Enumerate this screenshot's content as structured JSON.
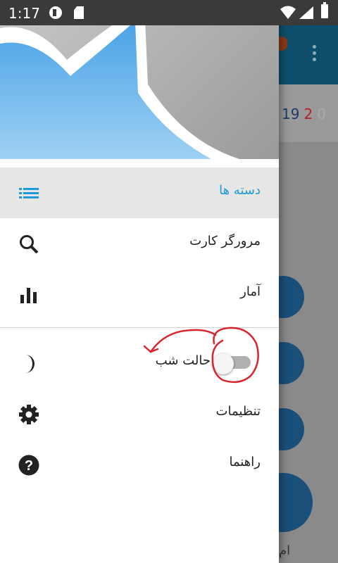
{
  "status_bar": {
    "time": "1:17"
  },
  "background_app": {
    "counts": [
      {
        "value": "19",
        "color": "#1a3a66"
      },
      {
        "value": "2",
        "color": "#b0202a"
      },
      {
        "value": "0",
        "color": "#aaaaaa"
      }
    ],
    "bottom_text": "ام"
  },
  "drawer": {
    "menu": [
      {
        "id": "categories",
        "label": "دسته ها",
        "icon": "list-icon",
        "selected": true
      },
      {
        "id": "card-browser",
        "label": "مرورگر کارت",
        "icon": "search-icon"
      },
      {
        "id": "statistics",
        "label": "آمار",
        "icon": "bar-chart-icon"
      },
      {
        "id": "night-mode",
        "label": "حالت شب",
        "icon": "moon-icon",
        "toggle_on": false
      },
      {
        "id": "settings",
        "label": "تنظیمات",
        "icon": "gear-icon"
      },
      {
        "id": "help",
        "label": "راهنما",
        "icon": "help-icon"
      }
    ]
  },
  "colors": {
    "accent": "#1e9ad6",
    "header_blue": "#64aee8",
    "annotation": "#d8242c"
  }
}
